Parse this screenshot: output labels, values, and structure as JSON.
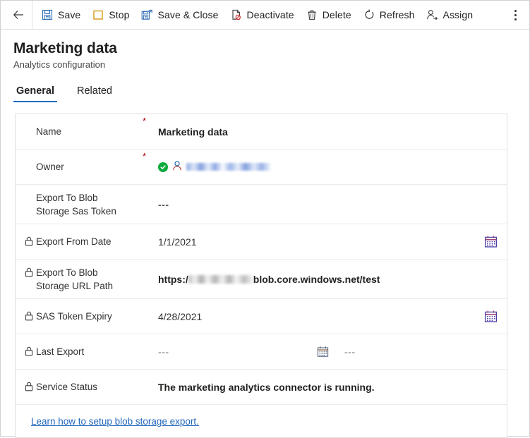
{
  "commandbar": {
    "back_label": "Back",
    "more_label": "More commands",
    "buttons": [
      {
        "id": "save",
        "label": "Save",
        "icon": "save-icon"
      },
      {
        "id": "stop",
        "label": "Stop",
        "icon": "stop-icon"
      },
      {
        "id": "save-close",
        "label": "Save & Close",
        "icon": "save-and-close-icon"
      },
      {
        "id": "deactivate",
        "label": "Deactivate",
        "icon": "deactivate-icon"
      },
      {
        "id": "delete",
        "label": "Delete",
        "icon": "trash-icon"
      },
      {
        "id": "refresh",
        "label": "Refresh",
        "icon": "refresh-icon"
      },
      {
        "id": "assign",
        "label": "Assign",
        "icon": "assign-user-icon"
      }
    ]
  },
  "header": {
    "title": "Marketing data",
    "subtitle": "Analytics configuration"
  },
  "tabs": [
    {
      "label": "General",
      "active": true
    },
    {
      "label": "Related",
      "active": false
    }
  ],
  "form": {
    "fields": {
      "name": {
        "label": "Name",
        "required": "*",
        "value": "Marketing data"
      },
      "owner": {
        "label": "Owner",
        "required": "*",
        "value": ""
      },
      "sas_token": {
        "label_line1": "Export To Blob",
        "label_line2": "Storage Sas Token",
        "value": "---"
      },
      "export_from_date": {
        "label": "Export From Date",
        "value": "1/1/2021"
      },
      "url_path": {
        "label_line1": "Export To Blob",
        "label_line2": "Storage URL Path",
        "value_prefix": "https:/",
        "value_suffix": "blob.core.windows.net/test"
      },
      "sas_token_expiry": {
        "label": "SAS Token Expiry",
        "value": "4/28/2021"
      },
      "last_export": {
        "label": "Last Export",
        "value_date": "---",
        "value_time": "---"
      },
      "service_status": {
        "label": "Service Status",
        "value": "The marketing analytics connector is running."
      }
    },
    "link": {
      "label": "Learn how to setup blob storage export."
    }
  },
  "colors": {
    "accent": "#0f6cbd",
    "required": "#a80000",
    "link": "#2266bb",
    "success": "#0eab3f",
    "save_icon": "#0f6cbd",
    "stop_icon": "#d18f00",
    "deactivate_icon": "#d13438",
    "calendar_outline": "#4a3fa8",
    "border": "#e1dfdd"
  }
}
